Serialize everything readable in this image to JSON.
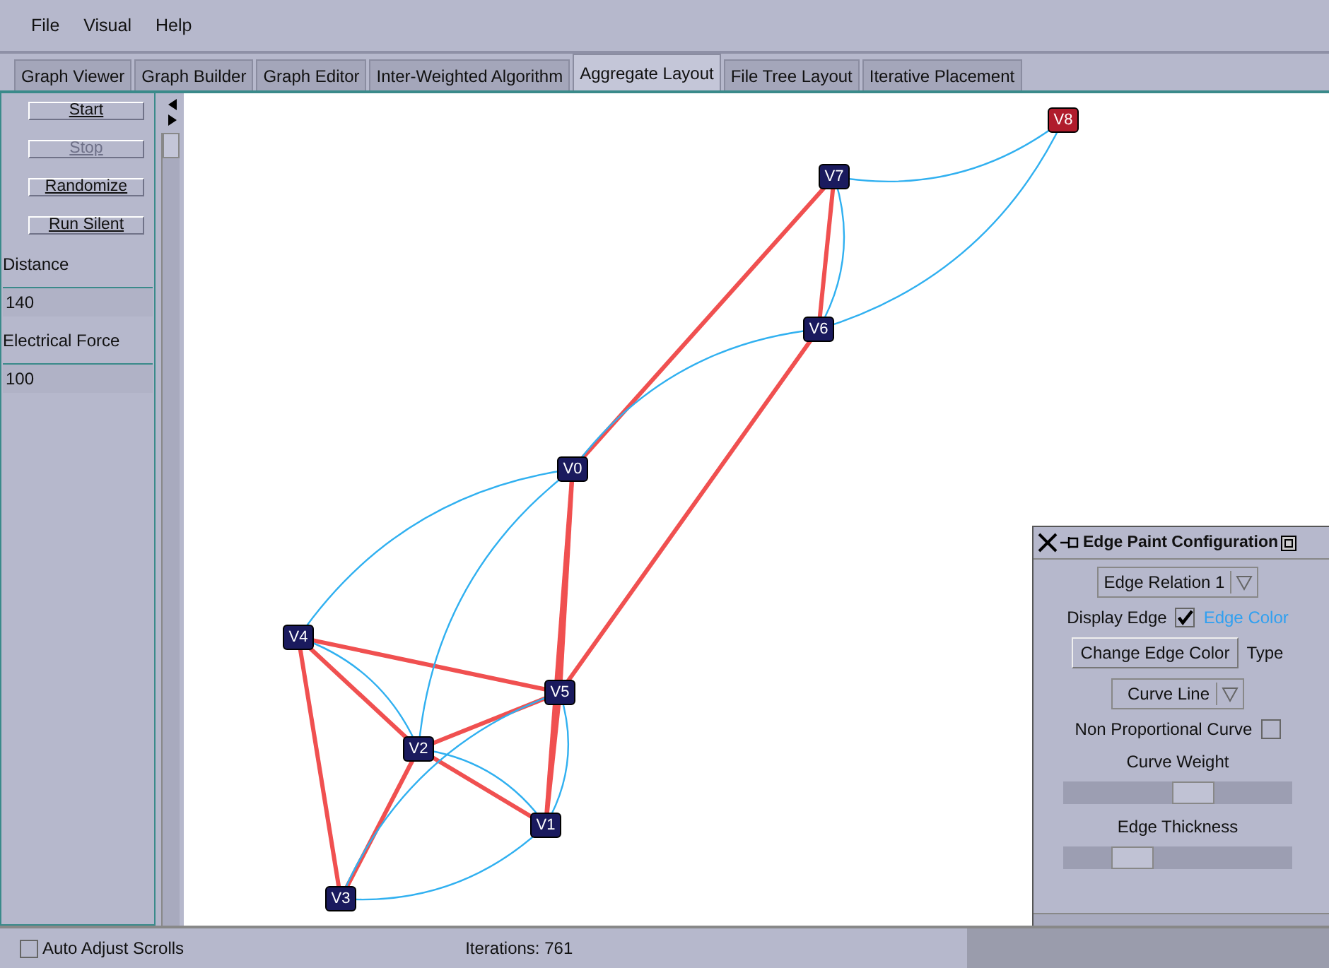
{
  "menu": [
    "File",
    "Visual",
    "Help"
  ],
  "tabs": [
    {
      "label": "Graph Viewer",
      "selected": false
    },
    {
      "label": "Graph Builder",
      "selected": false
    },
    {
      "label": "Graph Editor",
      "selected": false
    },
    {
      "label": "Inter-Weighted Algorithm",
      "selected": false
    },
    {
      "label": "Aggregate Layout",
      "selected": true
    },
    {
      "label": "File Tree Layout",
      "selected": false
    },
    {
      "label": "Iterative Placement",
      "selected": false
    }
  ],
  "controls": [
    {
      "kind": "button",
      "label": "Start",
      "disabled": false
    },
    {
      "kind": "button",
      "label": "Stop",
      "disabled": true
    },
    {
      "kind": "button",
      "label": "Randomize",
      "disabled": false
    },
    {
      "kind": "button",
      "label": "Run Silent",
      "disabled": false
    },
    {
      "kind": "field",
      "label": "Distance",
      "value": "140"
    },
    {
      "kind": "field",
      "label": "Electrical Force",
      "value": "100"
    }
  ],
  "nodes": [
    {
      "label": "V0",
      "color": "#1a1a5e"
    },
    {
      "label": "V1",
      "color": "#1a1a5e"
    },
    {
      "label": "V2",
      "color": "#1a1a5e"
    },
    {
      "label": "V3",
      "color": "#1a1a5e"
    },
    {
      "label": "V4",
      "color": "#1a1a5e"
    },
    {
      "label": "V5",
      "color": "#1a1a5e"
    },
    {
      "label": "V6",
      "color": "#1a1a5e"
    },
    {
      "label": "V7",
      "color": "#1a1a5e"
    },
    {
      "label": "V8",
      "color": "#b01c2c"
    }
  ],
  "dialog": {
    "title": "Edge Paint Configuration",
    "relation": "Edge Relation 1",
    "display_edge": {
      "label": "Display Edge",
      "checked": true
    },
    "edge_color_label": "Edge Color",
    "change_button": "Change Edge Color",
    "type_label": "Type",
    "line_type": "Curve Line",
    "non_proportional": {
      "label": "Non Proportional Curve",
      "checked": false
    },
    "sliders": [
      {
        "label": "Curve Weight",
        "level": 0.57
      },
      {
        "label": "Edge Thickness",
        "level": 0.3
      }
    ]
  },
  "status_bar": {
    "auto_adjust": {
      "label": "Auto Adjust Scrolls",
      "checked": false
    },
    "iterations": "Iterations: 761"
  }
}
